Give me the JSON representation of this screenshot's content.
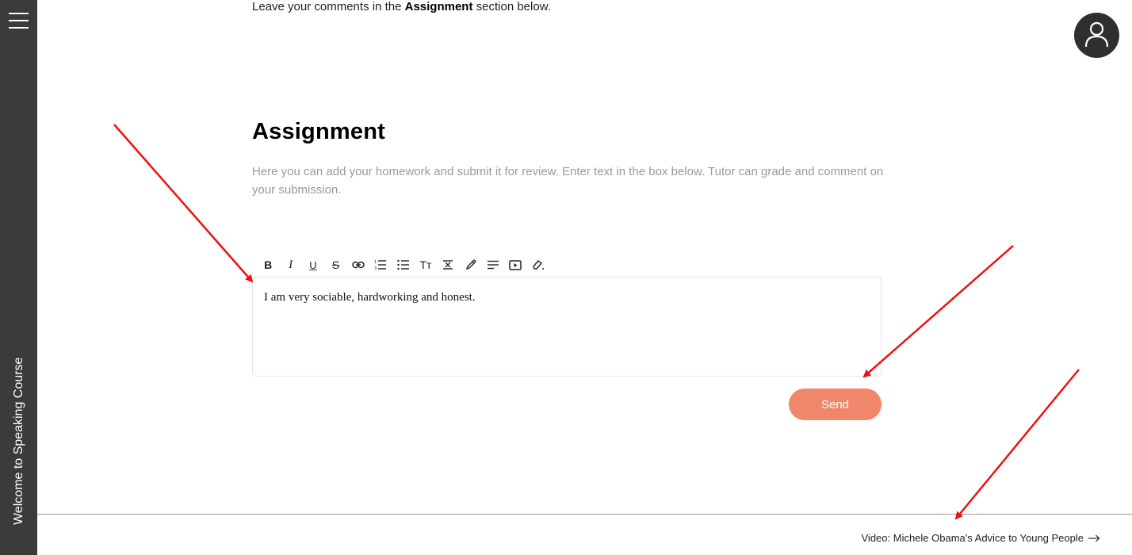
{
  "sidebar": {
    "menu_icon": "hamburger-menu-icon",
    "title": "Welcome to Speaking Course"
  },
  "header": {
    "avatar_icon": "user-avatar-icon"
  },
  "intro": {
    "text_before": "Leave your comments in the ",
    "text_bold": "Assignment",
    "text_after": " section below."
  },
  "assignment": {
    "heading": "Assignment",
    "description": "Here you can add your homework and submit it for review. Enter text in the box below. Tutor can grade and comment on your submission.",
    "toolbar": [
      "bold",
      "italic",
      "underline",
      "strikethrough",
      "link",
      "ordered-list",
      "bullet-list",
      "text-size",
      "line-height",
      "eyedropper",
      "align",
      "video",
      "eraser"
    ],
    "toolbar_labels": {
      "bold": "B",
      "italic": "I",
      "underline": "U",
      "strikethrough": "S",
      "text_size": "Tт"
    },
    "editor_value": "I am very sociable, hardworking and honest.",
    "send_label": "Send"
  },
  "footer": {
    "next_label": "Video: Michele Obama's Advice to Young People",
    "next_icon": "arrow-right-icon"
  },
  "colors": {
    "sidebar": "#3b3b3b",
    "send_button": "#f0876b",
    "annotation_arrow": "#ee1111",
    "description_text": "#9a9a9a"
  }
}
